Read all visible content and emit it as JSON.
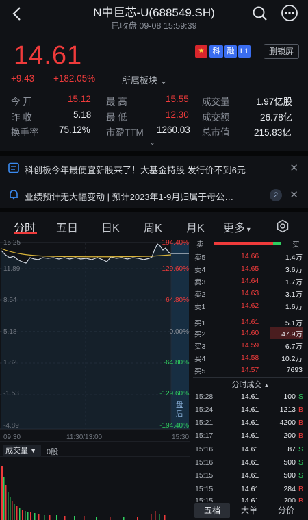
{
  "header": {
    "title": "N中巨芯-U(688549.SH)",
    "status": "已收盘 09-08 15:59:39"
  },
  "quote": {
    "price": "14.61",
    "change": "+9.43",
    "change_pct": "+182.05%",
    "sector_link": "所属板块",
    "flag": "★",
    "tags": [
      "科",
      "融",
      "L1"
    ],
    "screen_button": "删锁屏"
  },
  "stats": [
    {
      "label": "今  开",
      "value": "15.12"
    },
    {
      "label": "最  高",
      "value": "15.55"
    },
    {
      "label": "成交量",
      "value": "1.97亿股"
    },
    {
      "label": "昨  收",
      "value": "5.18"
    },
    {
      "label": "最  低",
      "value": "12.30"
    },
    {
      "label": "成交额",
      "value": "26.78亿"
    },
    {
      "label": "换手率",
      "value": "75.12%"
    },
    {
      "label": "市盈TTM",
      "value": "1260.03"
    },
    {
      "label": "总市值",
      "value": "215.83亿"
    }
  ],
  "banners": [
    {
      "text": "科创板今年最便宜新股来了！大基金持股 发行价不到6元"
    },
    {
      "text": "业绩预计无大幅变动 | 预计2023年1-9月归属于母公…",
      "badge": "2"
    }
  ],
  "tabs": [
    "分时",
    "五日",
    "日K",
    "周K",
    "月K",
    "更多"
  ],
  "chart": {
    "left_axis": [
      "15.25",
      "11.89",
      "8.54",
      "5.18",
      "1.82",
      "-1.53",
      "-4.89"
    ],
    "right_axis": [
      "194.40%",
      "129.60%",
      "64.80%",
      "0.00%",
      "-64.80%",
      "-129.60%",
      "-194.40%"
    ],
    "time_axis": [
      "09:30",
      "11:30/13:00",
      "15:30"
    ],
    "after_hours": "盘后",
    "volume_label": "成交量",
    "volume_value": "0股"
  },
  "orderbook": {
    "sell_label": "卖",
    "buy_label": "买",
    "asks": [
      {
        "label": "卖5",
        "price": "14.66",
        "vol": "1.4万"
      },
      {
        "label": "卖4",
        "price": "14.65",
        "vol": "3.6万"
      },
      {
        "label": "卖3",
        "price": "14.64",
        "vol": "1.7万"
      },
      {
        "label": "卖2",
        "price": "14.63",
        "vol": "3.1万"
      },
      {
        "label": "卖1",
        "price": "14.62",
        "vol": "1.6万"
      }
    ],
    "bids": [
      {
        "label": "买1",
        "price": "14.61",
        "vol": "5.1万"
      },
      {
        "label": "买2",
        "price": "14.60",
        "vol": "47.9万"
      },
      {
        "label": "买3",
        "price": "14.59",
        "vol": "6.7万"
      },
      {
        "label": "买4",
        "price": "14.58",
        "vol": "10.2万"
      },
      {
        "label": "买5",
        "price": "14.57",
        "vol": "7693"
      }
    ],
    "trades_title": "分时成交",
    "trades": [
      {
        "time": "15:28",
        "price": "14.61",
        "vol": "100",
        "side": "S"
      },
      {
        "time": "15:24",
        "price": "14.61",
        "vol": "1213",
        "side": "B"
      },
      {
        "time": "15:21",
        "price": "14.61",
        "vol": "4200",
        "side": "B"
      },
      {
        "time": "15:17",
        "price": "14.61",
        "vol": "200",
        "side": "B"
      },
      {
        "time": "15:16",
        "price": "14.61",
        "vol": "87",
        "side": "S"
      },
      {
        "time": "15:16",
        "price": "14.61",
        "vol": "500",
        "side": "S"
      },
      {
        "time": "15:15",
        "price": "14.61",
        "vol": "500",
        "side": "S"
      },
      {
        "time": "15:15",
        "price": "14.61",
        "vol": "284",
        "side": "B"
      },
      {
        "time": "15:15",
        "price": "14.61",
        "vol": "200",
        "side": "B"
      }
    ],
    "bottom_tabs": [
      "五档",
      "大单",
      "分价"
    ]
  },
  "colors": {
    "up": "#ef3b3b",
    "down": "#2fcf5f",
    "bg": "#101216",
    "accent_blue": "#3a6df0",
    "avg_line": "#d9b43a",
    "price_line": "#cfd6e0"
  }
}
